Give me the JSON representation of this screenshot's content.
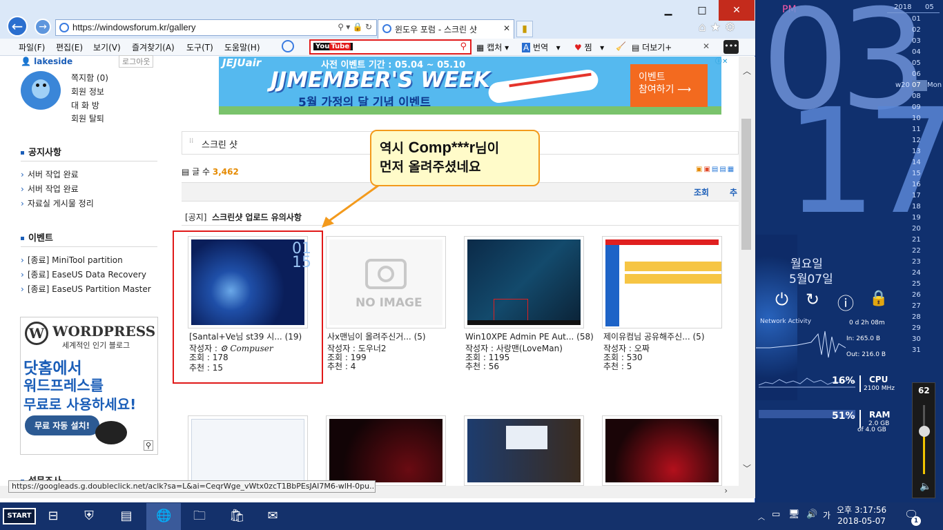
{
  "browser": {
    "url": "https://windowsforum.kr/gallery",
    "tab_title": "윈도우 포럼 - 스크린 샷",
    "window_buttons": {
      "min": "▁",
      "max": "□",
      "close": "✕"
    },
    "menu": [
      "파일(F)",
      "편집(E)",
      "보기(V)",
      "즐겨찾기(A)",
      "도구(T)",
      "도움말(H)"
    ],
    "toolbar": {
      "capture": "캡처",
      "translate": "번역",
      "zzim": "찜",
      "more": "더보기+"
    },
    "search_brand": "You",
    "search_brand2": "Tube",
    "status_url": "https://googleads.g.doubleclick.net/aclk?sa=L&ai=CeqrWge_vWtx0zcT1BbPEsJAI7M6-wlH-0pu..."
  },
  "sidebar": {
    "username": "lakeside",
    "logout": "로그아웃",
    "user_links": [
      "쪽지함 (0)",
      "회원 정보",
      "대 화 방",
      "회원 탈퇴"
    ],
    "notice_title": "공지사항",
    "notices": [
      "서버 작업 완료",
      "서버 작업 완료",
      "자료실 게시물 정리"
    ],
    "event_title": "이벤트",
    "events": [
      "[종료] MiniTool partition",
      "[종료] EaseUS Data Recovery",
      "[종료] EaseUS Partition Master"
    ],
    "wp_ad": {
      "brand": "WORDPRESS",
      "tagline": "세계적인 인기 블로그",
      "line1": "닷홈에서",
      "line2": "워드프레스를",
      "line3": "무료로 사용하세요!",
      "button": "무료 자동 설치!"
    },
    "survey": "설문조사"
  },
  "banner": {
    "brand": "JEJUair",
    "period": "사전 이벤트 기간 : 05.04 ~ 05.10",
    "headline": "JJMEMBER'S WEEK",
    "sub": "5월 가정의 달 기념 이벤트",
    "button_line1": "이벤트",
    "button_line2": "참여하기"
  },
  "board": {
    "section": "스크린 샷",
    "count_label": "글 수",
    "count": "3,462",
    "sort_view": "조회",
    "sort_rec": "추",
    "notice_tag": "[공지]",
    "notice_title": "스크린샷 업로드 유의사항"
  },
  "callout": {
    "line1a": "역시 ",
    "line1b": "Comp***r",
    "line1c": "님이",
    "line2": "먼저 올려주셨네요"
  },
  "posts": [
    {
      "title": "[Santal+Ve님 st39 시...",
      "comments": "(19)",
      "author_label": "작성자 : ",
      "author": "Compuser",
      "views": "조회 : 178",
      "recommend": "추천 : 15"
    },
    {
      "title": "사x맨님이 올려주신거...",
      "comments": "(5)",
      "author_label": "작성자 : ",
      "author": "도우너2",
      "views": "조회 : 199",
      "recommend": "추천 : 4",
      "noimage": "NO IMAGE"
    },
    {
      "title": "Win10XPE Admin PE Aut...",
      "comments": "(58)",
      "author_label": "작성자 : ",
      "author": "사랑맨(LoveMan)",
      "views": "조회 : 1195",
      "recommend": "추천 : 56"
    },
    {
      "title": "제이유컴님 공유해주신...",
      "comments": "(5)",
      "author_label": "작성자 : ",
      "author": "오짜",
      "views": "조회 : 530",
      "recommend": "추천 : 5"
    }
  ],
  "desktop": {
    "ampm": "PM",
    "hour": "03",
    "minute": "17",
    "day": "월요일",
    "date": "5월07일",
    "year": "2018",
    "month": "05",
    "cal_days": [
      "01",
      "02",
      "03",
      "04",
      "05",
      "06",
      "07",
      "08",
      "09",
      "10",
      "11",
      "12",
      "13",
      "14",
      "15",
      "16",
      "17",
      "18",
      "19",
      "20",
      "21",
      "22",
      "23",
      "24",
      "25",
      "26",
      "27",
      "28",
      "29",
      "30",
      "31"
    ],
    "week": "w20",
    "weekday_short": "Mon",
    "network_title": "Network Activity",
    "uptime": "0 d 2h 08m",
    "net_in": "In: 265.0 B",
    "net_out": "Out: 216.0 B",
    "cpu_pct": "16%",
    "cpu_label": "CPU",
    "cpu_mhz": "2100 MHz",
    "ram_pct": "51%",
    "ram_label": "RAM",
    "ram_used": "2.0 GB",
    "ram_total": "of 4.0 GB",
    "volume": "62"
  },
  "taskbar": {
    "start": "START",
    "time": "오후 3:17:56",
    "date": "2018-05-07",
    "ime": "가",
    "notif_count": "1"
  }
}
